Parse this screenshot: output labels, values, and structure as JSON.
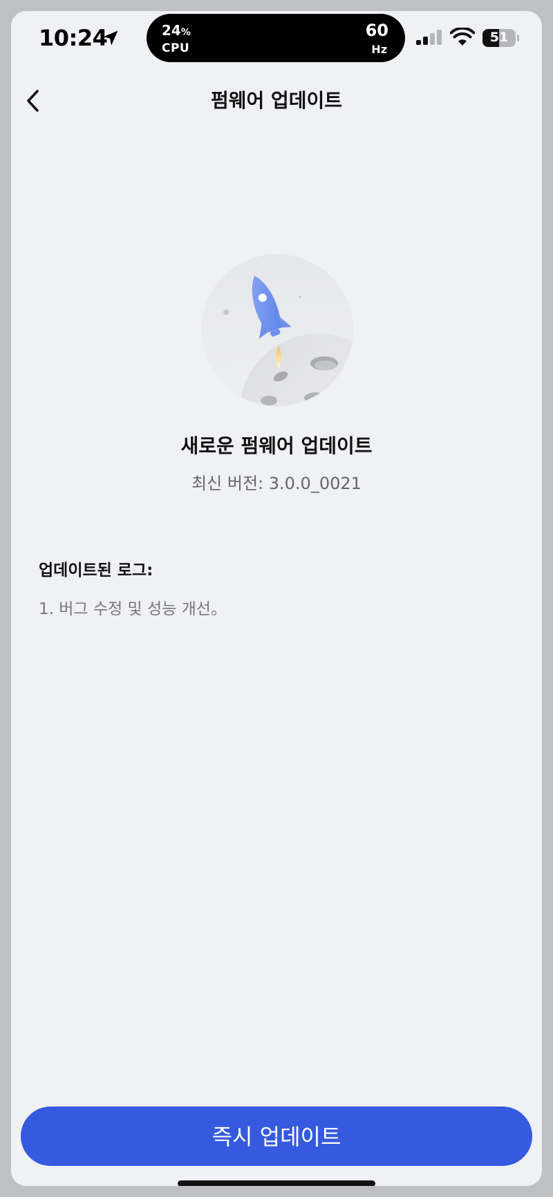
{
  "status_bar": {
    "time": "10:24",
    "cpu_value": "24",
    "cpu_unit": "%",
    "cpu_label": "CPU",
    "refresh_value": "60",
    "refresh_unit": "Hz",
    "battery_level": "51",
    "battery_fraction": 0.51,
    "icons": [
      "location-arrow-icon",
      "signal-icon",
      "wifi-icon",
      "battery-icon"
    ]
  },
  "nav": {
    "title": "펌웨어 업데이트",
    "back_icon": "chevron-left-icon"
  },
  "hero": {
    "illustration": "rocket-moon-illustration",
    "heading": "새로운 펌웨어 업데이트",
    "version_label": "최신 버전: 3.0.0_0021"
  },
  "changelog": {
    "title": "업데이트된 로그:",
    "items": [
      "1. 버그 수정 및 성능 개선。"
    ]
  },
  "actions": {
    "update_now": "즉시 업데이트"
  },
  "colors": {
    "background": "#f0f1f5",
    "primary": "#355ae0",
    "rocket": "#7b9cf0"
  }
}
